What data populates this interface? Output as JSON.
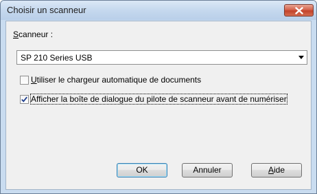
{
  "window": {
    "title": "Choisir un scanneur"
  },
  "scanner": {
    "label_accel": "S",
    "label_rest": "canneur :",
    "selected": "SP 210 Series USB"
  },
  "options": {
    "adf": {
      "accel": "U",
      "rest": "tiliser le chargeur automatique de documents",
      "checked": false
    },
    "show_driver": {
      "label": "Afficher la boîte de dialogue du pilote de scanneur avant de numériser",
      "checked": true
    }
  },
  "buttons": {
    "ok": "OK",
    "cancel": "Annuler",
    "help_accel": "A",
    "help_rest": "ide"
  },
  "colors": {
    "close_button": "#c2432b",
    "title_bar": "#c5d8ee",
    "client_bg": "#f0f0f0",
    "default_button_border": "#3c7fb1"
  }
}
